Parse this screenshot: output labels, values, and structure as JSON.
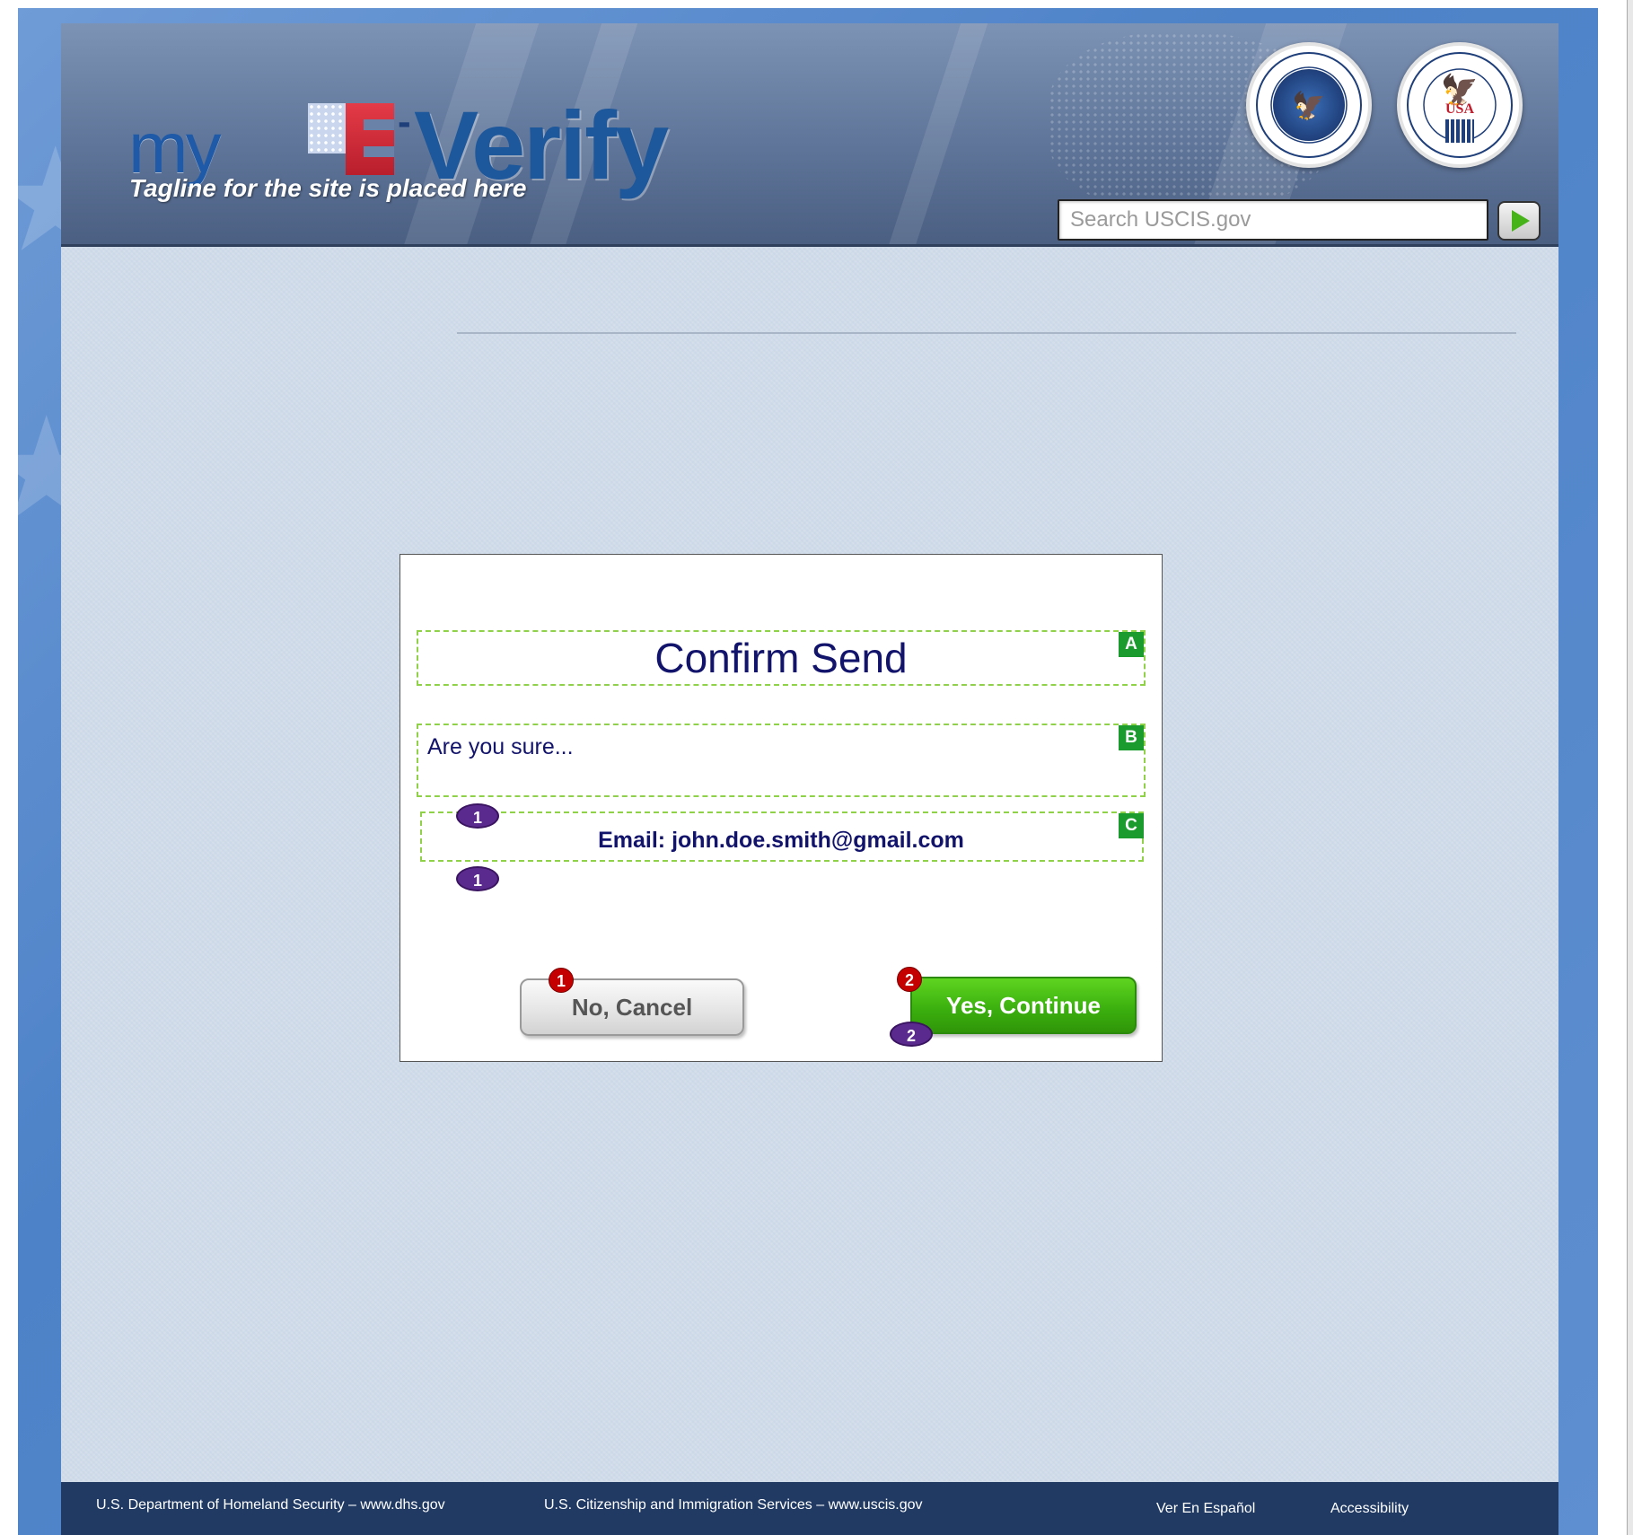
{
  "header": {
    "logo_my": "my",
    "logo_dash": "-",
    "logo_verify": "Verify",
    "tagline": "Tagline for the site is placed here",
    "seals": {
      "dhs_icon": "dhs-seal",
      "ssa_icon": "ssa-seal",
      "ssa_usa": "USA"
    },
    "search": {
      "placeholder": "Search USCIS.gov",
      "go_icon": "play-arrow"
    }
  },
  "modal": {
    "title": "Confirm Send",
    "question": "Are you sure...",
    "email": "Email: john.doe.smith@gmail.com",
    "cancel_label": "No, Cancel",
    "continue_label": "Yes, Continue"
  },
  "annotations": {
    "tag_a": "A",
    "tag_b": "B",
    "tag_c": "C",
    "marker_cancel": "1",
    "marker_continue": "2",
    "marker_question": "1",
    "marker_email": "1",
    "marker_continue_bottom": "2"
  },
  "footer": {
    "dhs": "U.S. Department of Homeland Security – www.dhs.gov",
    "uscis": "U.S. Citizenship and Immigration Services – www.uscis.gov",
    "spanish": "Ver En Español",
    "accessibility": "Accessibility"
  },
  "colors": {
    "frame_blue": "#4d82c8",
    "page_bg": "#ccd8e7",
    "title_navy": "#12136b",
    "continue_green": "#3cb10f",
    "footer_navy": "#203a63",
    "annotation_green": "#1b9a2e",
    "marker_red": "#c40000",
    "marker_purple": "#5b2a8f"
  }
}
